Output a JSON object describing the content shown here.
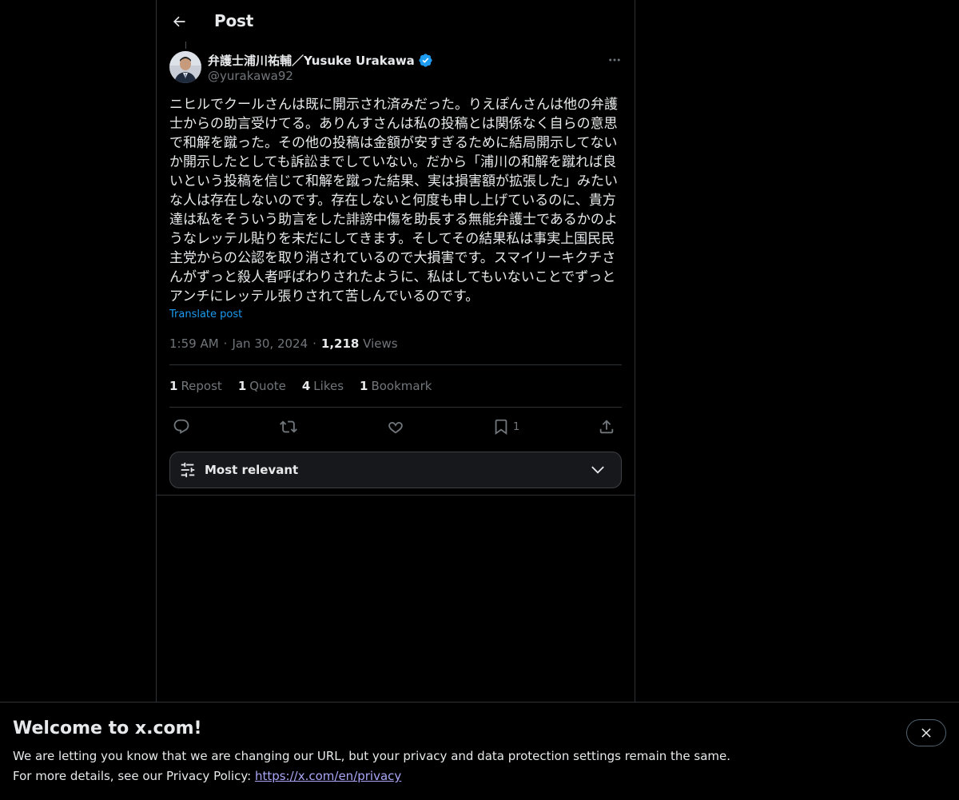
{
  "header": {
    "title": "Post"
  },
  "post": {
    "author_name": "弁護士浦川祐輔／Yusuke Urakawa",
    "handle": "@yurakawa92",
    "text": "ニヒルでクールさんは既に開示され済みだった。りえぽんさんは他の弁護士からの助言受けてる。ありんすさんは私の投稿とは関係なく自らの意思で和解を蹴った。その他の投稿は金額が安すぎるために結局開示してないか開示したとしても訴訟までしていない。だから「浦川の和解を蹴れば良いという投稿を信じて和解を蹴った結果、実は損害額が拡張した」みたいな人は存在しないのです。存在しないと何度も申し上げているのに、貴方達は私をそういう助言をした誹謗中傷を助長する無能弁護士であるかのようなレッテル貼りを未だにしてきます。そしてその結果私は事実上国民民主党からの公認を取り消されているので大損害です。スマイリーキクチさんがずっと殺人者呼ばわりされたように、私はしてもいないことでずっとアンチにレッテル張りされて苦しんでいるのです。",
    "translate_label": "Translate post",
    "time": "1:59 AM",
    "date": "Jan 30, 2024",
    "views_count": "1,218",
    "views_label": "Views",
    "separator": "·"
  },
  "stats": {
    "reposts_count": "1",
    "reposts_label": "Repost",
    "quotes_count": "1",
    "quotes_label": "Quote",
    "likes_count": "4",
    "likes_label": "Likes",
    "bookmarks_count": "1",
    "bookmarks_label": "Bookmark"
  },
  "actions": {
    "bookmark_count": "1"
  },
  "sort": {
    "label": "Most relevant"
  },
  "banner": {
    "title": "Welcome to x.com!",
    "line1": "We are letting you know that we are changing our URL, but your privacy and data protection settings remain the same.",
    "line2_prefix": "For more details, see our Privacy Policy: ",
    "link": "https://x.com/en/privacy"
  },
  "colors": {
    "background": "#000000",
    "text": "#e7e9ea",
    "muted": "#71767b",
    "accent": "#1d9bf0",
    "border": "#2f3336"
  },
  "icons": [
    "back-arrow-icon",
    "verified-badge-icon",
    "more-icon",
    "reply-icon",
    "repost-icon",
    "like-icon",
    "bookmark-icon",
    "share-icon",
    "sort-sliders-icon",
    "chevron-down-icon",
    "close-icon"
  ]
}
